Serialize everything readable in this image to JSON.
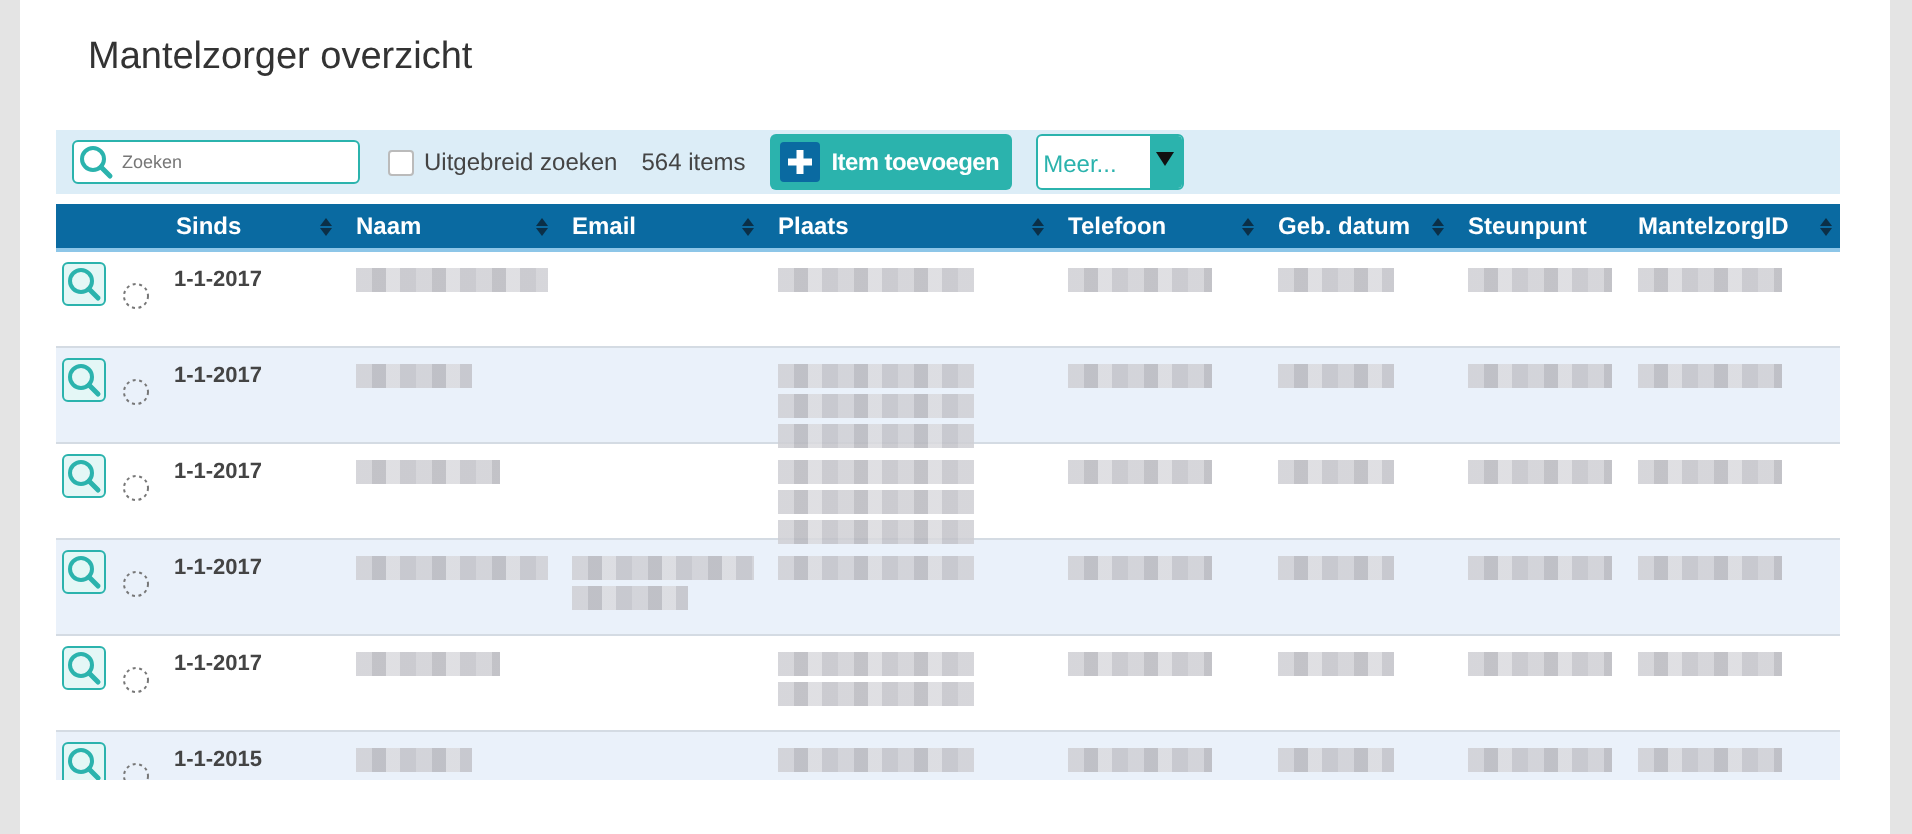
{
  "title": "Mantelzorger overzicht",
  "toolbar": {
    "search": {
      "placeholder": "Zoeken"
    },
    "extended_search": {
      "label": "Uitgebreid zoeken",
      "checked": false
    },
    "count": "564 items",
    "add_button": "Item toevoegen",
    "more_select": {
      "value": "Meer..."
    }
  },
  "table": {
    "columns": [
      {
        "label": "Sinds",
        "sortable": true
      },
      {
        "label": "Naam",
        "sortable": true
      },
      {
        "label": "Email",
        "sortable": true
      },
      {
        "label": "Plaats",
        "sortable": true
      },
      {
        "label": "Telefoon",
        "sortable": true
      },
      {
        "label": "Geb. datum",
        "sortable": true
      },
      {
        "label": "Steunpunt",
        "sortable": false
      },
      {
        "label": "MantelzorgID",
        "sortable": true
      }
    ],
    "rows": [
      {
        "sinds": "1-1-2017",
        "cells": [
          {
            "kind": "blurred",
            "lines": [
              {
                "kind": "long"
              }
            ]
          },
          {
            "kind": "empty"
          },
          {
            "kind": "blurred",
            "lines": [
              {
                "kind": "long"
              }
            ]
          },
          {
            "kind": "blurred",
            "lines": [
              {
                "kind": "medium"
              }
            ]
          },
          {
            "kind": "blurred",
            "lines": [
              {
                "kind": "short"
              }
            ]
          },
          {
            "kind": "blurred",
            "lines": [
              {
                "kind": "medium"
              }
            ]
          },
          {
            "kind": "blurred",
            "lines": [
              {
                "kind": "medium"
              }
            ]
          }
        ]
      },
      {
        "sinds": "1-1-2017",
        "cells": [
          {
            "kind": "blurred",
            "lines": [
              {
                "kind": "short"
              }
            ]
          },
          {
            "kind": "empty"
          },
          {
            "kind": "blurred",
            "lines": [
              {
                "kind": "long"
              },
              {
                "kind": "long"
              },
              {
                "kind": "long"
              }
            ]
          },
          {
            "kind": "blurred",
            "lines": [
              {
                "kind": "medium"
              }
            ]
          },
          {
            "kind": "blurred",
            "lines": [
              {
                "kind": "short"
              }
            ]
          },
          {
            "kind": "blurred",
            "lines": [
              {
                "kind": "medium"
              }
            ]
          },
          {
            "kind": "blurred",
            "lines": [
              {
                "kind": "medium"
              }
            ]
          }
        ]
      },
      {
        "sinds": "1-1-2017",
        "cells": [
          {
            "kind": "blurred",
            "lines": [
              {
                "kind": "medium"
              }
            ]
          },
          {
            "kind": "empty"
          },
          {
            "kind": "blurred",
            "lines": [
              {
                "kind": "long"
              },
              {
                "kind": "long"
              },
              {
                "kind": "long"
              }
            ]
          },
          {
            "kind": "blurred",
            "lines": [
              {
                "kind": "medium"
              }
            ]
          },
          {
            "kind": "blurred",
            "lines": [
              {
                "kind": "short"
              }
            ]
          },
          {
            "kind": "blurred",
            "lines": [
              {
                "kind": "medium"
              }
            ]
          },
          {
            "kind": "blurred",
            "lines": [
              {
                "kind": "medium"
              }
            ]
          }
        ]
      },
      {
        "sinds": "1-1-2017",
        "cells": [
          {
            "kind": "blurred",
            "lines": [
              {
                "kind": "long"
              }
            ]
          },
          {
            "kind": "blurred",
            "lines": [
              {
                "kind": "long"
              },
              {
                "kind": "short"
              }
            ]
          },
          {
            "kind": "blurred",
            "lines": [
              {
                "kind": "long"
              }
            ]
          },
          {
            "kind": "blurred",
            "lines": [
              {
                "kind": "medium"
              }
            ]
          },
          {
            "kind": "blurred",
            "lines": [
              {
                "kind": "short"
              }
            ]
          },
          {
            "kind": "blurred",
            "lines": [
              {
                "kind": "medium"
              }
            ]
          },
          {
            "kind": "blurred",
            "lines": [
              {
                "kind": "medium"
              }
            ]
          }
        ]
      },
      {
        "sinds": "1-1-2017",
        "cells": [
          {
            "kind": "blurred",
            "lines": [
              {
                "kind": "medium"
              }
            ]
          },
          {
            "kind": "empty"
          },
          {
            "kind": "blurred",
            "lines": [
              {
                "kind": "long"
              },
              {
                "kind": "long"
              }
            ]
          },
          {
            "kind": "blurred",
            "lines": [
              {
                "kind": "medium"
              }
            ]
          },
          {
            "kind": "blurred",
            "lines": [
              {
                "kind": "short"
              }
            ]
          },
          {
            "kind": "blurred",
            "lines": [
              {
                "kind": "medium"
              }
            ]
          },
          {
            "kind": "blurred",
            "lines": [
              {
                "kind": "medium"
              }
            ]
          }
        ]
      },
      {
        "sinds": "1-1-2015",
        "cells": [
          {
            "kind": "blurred",
            "lines": [
              {
                "kind": "short"
              }
            ]
          },
          {
            "kind": "empty"
          },
          {
            "kind": "blurred",
            "lines": [
              {
                "kind": "long"
              }
            ]
          },
          {
            "kind": "blurred",
            "lines": [
              {
                "kind": "medium"
              }
            ]
          },
          {
            "kind": "blurred",
            "lines": [
              {
                "kind": "short"
              }
            ]
          },
          {
            "kind": "blurred",
            "lines": [
              {
                "kind": "medium"
              }
            ]
          },
          {
            "kind": "blurred",
            "lines": [
              {
                "kind": "medium"
              }
            ]
          }
        ]
      }
    ]
  }
}
